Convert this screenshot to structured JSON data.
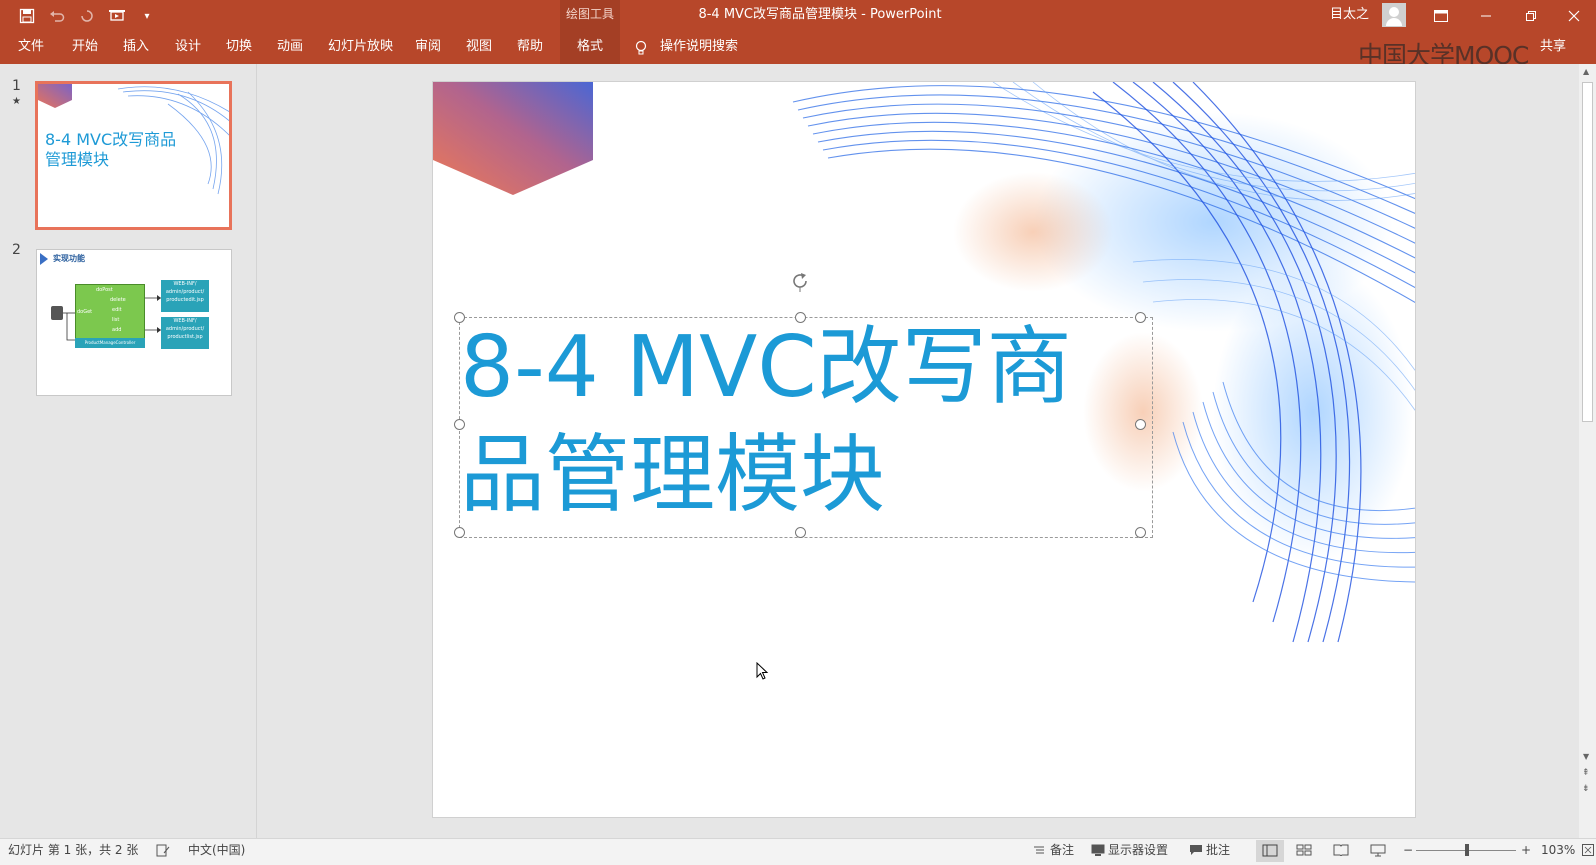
{
  "titlebar": {
    "context_tools": "绘图工具",
    "doc_title": "8-4 MVC改写商品管理模块 - PowerPoint",
    "user_name": "目太之",
    "qat_icons": [
      "save-icon",
      "undo-icon",
      "redo-icon",
      "start-from-beginning-icon",
      "customize-qat-icon"
    ],
    "window_controls": [
      "ribbon-display-icon",
      "minimize-icon",
      "restore-icon",
      "close-icon"
    ]
  },
  "ribbon": {
    "tabs": [
      {
        "label": "文件"
      },
      {
        "label": "开始"
      },
      {
        "label": "插入"
      },
      {
        "label": "设计"
      },
      {
        "label": "切换"
      },
      {
        "label": "动画"
      },
      {
        "label": "幻灯片放映"
      },
      {
        "label": "审阅"
      },
      {
        "label": "视图"
      },
      {
        "label": "帮助"
      },
      {
        "label": "格式"
      }
    ],
    "tell_me": "操作说明搜索",
    "share": "共享",
    "watermark": "中国大学MOOC"
  },
  "thumbnails": {
    "slide1": {
      "number": "1",
      "marker": "★",
      "title": "8-4 MVC改写商品管理模块"
    },
    "slide2": {
      "number": "2",
      "title": "实现功能",
      "box_main": [
        "doPost",
        "delete",
        "edit",
        "list",
        "add"
      ],
      "box_doGet": "doGet",
      "box_controller": "ProductManageController",
      "jsp1": "WEB-INF/ admin/product/ productedit.jsp",
      "jsp2": "WEB-INF/ admin/product/ productlist.jsp"
    }
  },
  "slide": {
    "title": "8-4 MVC改写商品管理模块"
  },
  "statusbar": {
    "slide_info": "幻灯片 第 1 张，共 2 张",
    "language": "中文(中国)",
    "notes": "备注",
    "display_settings": "显示器设置",
    "comments": "批注",
    "zoom": "103%"
  },
  "colors": {
    "ribbon": "#b7472a",
    "title_text": "#1c9ad6",
    "selected_thumb_border": "#e8735a"
  }
}
